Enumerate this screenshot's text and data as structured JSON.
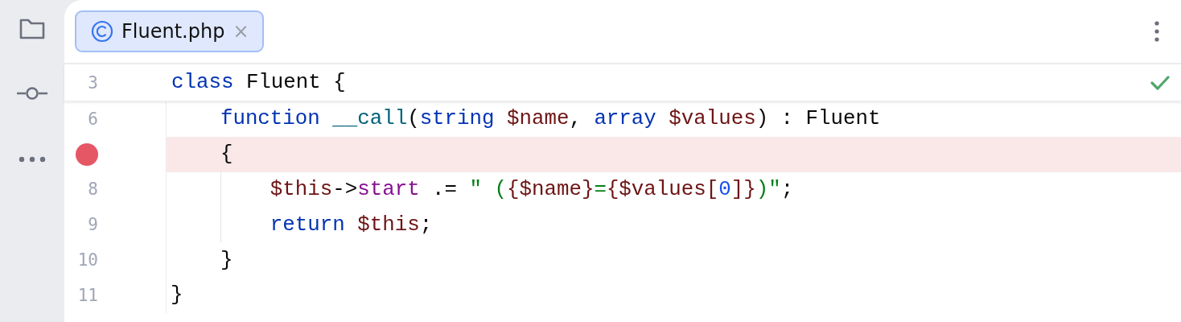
{
  "tabs": [
    {
      "label": "Fluent.php",
      "selected": true,
      "close": "×"
    }
  ],
  "sticky_line": {
    "number": "3",
    "tokens": [
      {
        "kind": "keyword",
        "text": "class"
      },
      {
        "kind": "plain",
        "text": " Fluent {"
      }
    ]
  },
  "lines": [
    {
      "number": "6",
      "breakpoint": false,
      "highlighted": false,
      "indent_guide": false,
      "tokens": [
        {
          "kind": "keyword",
          "text": "    function"
        },
        {
          "kind": "function",
          "text": " __call"
        },
        {
          "kind": "plain",
          "text": "("
        },
        {
          "kind": "keyword",
          "text": "string"
        },
        {
          "kind": "var",
          "text": " $name"
        },
        {
          "kind": "plain",
          "text": ", "
        },
        {
          "kind": "keyword",
          "text": "array"
        },
        {
          "kind": "var",
          "text": " $values"
        },
        {
          "kind": "plain",
          "text": ") : Fluent"
        }
      ]
    },
    {
      "breakpoint": true,
      "highlighted": true,
      "indent_guide": false,
      "tokens": [
        {
          "kind": "plain",
          "text": "    {"
        }
      ]
    },
    {
      "number": "8",
      "breakpoint": false,
      "highlighted": false,
      "indent_guide": true,
      "tokens": [
        {
          "kind": "var",
          "text": "        $this"
        },
        {
          "kind": "plain",
          "text": "->"
        },
        {
          "kind": "field",
          "text": "start"
        },
        {
          "kind": "plain",
          "text": " .= "
        },
        {
          "kind": "string",
          "text": "\" ("
        },
        {
          "kind": "var",
          "text": "{$name}"
        },
        {
          "kind": "string",
          "text": "="
        },
        {
          "kind": "var",
          "text": "{$values["
        },
        {
          "kind": "number",
          "text": "0"
        },
        {
          "kind": "var",
          "text": "]}"
        },
        {
          "kind": "string",
          "text": ")\""
        },
        {
          "kind": "plain",
          "text": ";"
        }
      ]
    },
    {
      "number": "9",
      "breakpoint": false,
      "highlighted": false,
      "indent_guide": true,
      "tokens": [
        {
          "kind": "keyword",
          "text": "        return"
        },
        {
          "kind": "var",
          "text": " $this"
        },
        {
          "kind": "plain",
          "text": ";"
        }
      ]
    },
    {
      "number": "10",
      "breakpoint": false,
      "highlighted": false,
      "indent_guide": false,
      "tokens": [
        {
          "kind": "plain",
          "text": "    }"
        }
      ]
    },
    {
      "number": "11",
      "breakpoint": false,
      "highlighted": false,
      "indent_guide": false,
      "tokens": [
        {
          "kind": "plain",
          "text": "}"
        }
      ]
    }
  ]
}
